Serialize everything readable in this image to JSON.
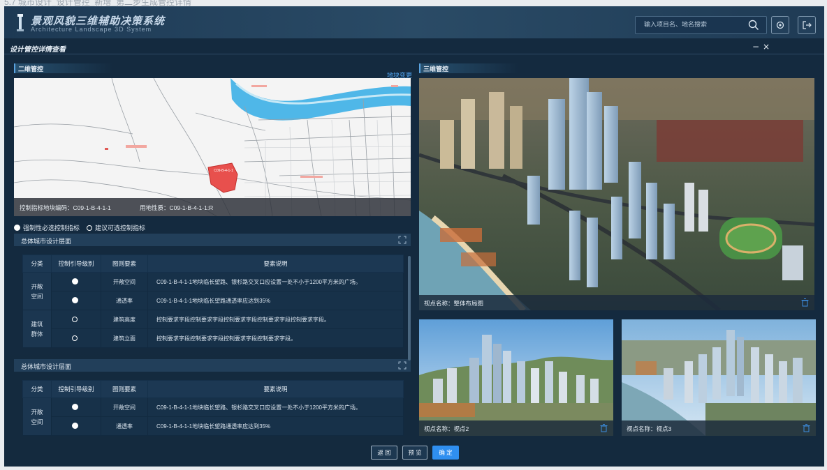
{
  "page_caption": "5.7  城市设计_设计管控_新增_第二步生成管控详情",
  "header": {
    "title": "景观风貌三维辅助决策系统",
    "subtitle": "Architecture Landscape 3D System",
    "search_placeholder": "输入项目名、地名搜索"
  },
  "modal": {
    "title": "设计管控详情查看",
    "minimize": "−",
    "close": "×"
  },
  "left": {
    "section_title": "二维管控",
    "change_link": "地块变更",
    "map": {
      "plot_label": "C09-B-4-1-1",
      "info_code": "控制指标地块编码：C09-1-B-4-1-1",
      "info_use": "用地性质：C09-1-B-4-1-1:R"
    },
    "legend": {
      "mandatory": "强制性必选控制指标",
      "suggested": "建议可选控制指标"
    },
    "groups": [
      {
        "title": "总体城市设计层面",
        "headers": [
          "分类",
          "控制引导级别",
          "图则要素",
          "要素说明"
        ],
        "rows": [
          {
            "category": "开敞空间",
            "level": "filled",
            "element": "开敞空间",
            "desc": "C09-1-B-4-1-1地块临长望路、银杉路交叉口应设置一处不小于1200平方米的广场。"
          },
          {
            "category": "开敞空间",
            "level": "filled",
            "element": "通透率",
            "desc": "C09-1-B-4-1-1地块临长望路通透率应达到35%"
          },
          {
            "category": "建筑群体",
            "level": "ring",
            "element": "建筑高度",
            "desc": "控制要求字段控制要求字段控制要求字段控制要求字段控制要求字段。"
          },
          {
            "category": "建筑群体",
            "level": "ring",
            "element": "建筑立面",
            "desc": "控制要求字段控制要求字段控制要求字段控制要求字段。"
          }
        ],
        "categories": [
          "开敞\n空间",
          "建筑\n群体"
        ]
      },
      {
        "title": "总体城市设计层面",
        "headers": [
          "分类",
          "控制引导级别",
          "图则要素",
          "要素说明"
        ],
        "rows": [
          {
            "category": "开敞空间",
            "level": "filled",
            "element": "开敞空间",
            "desc": "C09-1-B-4-1-1地块临长望路、银杉路交叉口应设置一处不小于1200平方米的广场。"
          },
          {
            "category": "开敞空间",
            "level": "filled",
            "element": "通透率",
            "desc": "C09-1-B-4-1-1地块临长望路通透率应达到35%"
          }
        ],
        "categories": [
          "开敞\n空间"
        ]
      }
    ]
  },
  "right": {
    "section_title": "三维管控",
    "views": [
      {
        "caption": "视点名称：整体布局图"
      },
      {
        "caption": "视点名称：视点2"
      },
      {
        "caption": "视点名称：视点3"
      }
    ]
  },
  "footer": {
    "back": "返 回",
    "preview": "预 览",
    "confirm": "确 定"
  },
  "colors": {
    "accent": "#2f8ff0",
    "link": "#4fa3ef",
    "plot_red": "#e8504d",
    "panel": "#142a3e"
  }
}
